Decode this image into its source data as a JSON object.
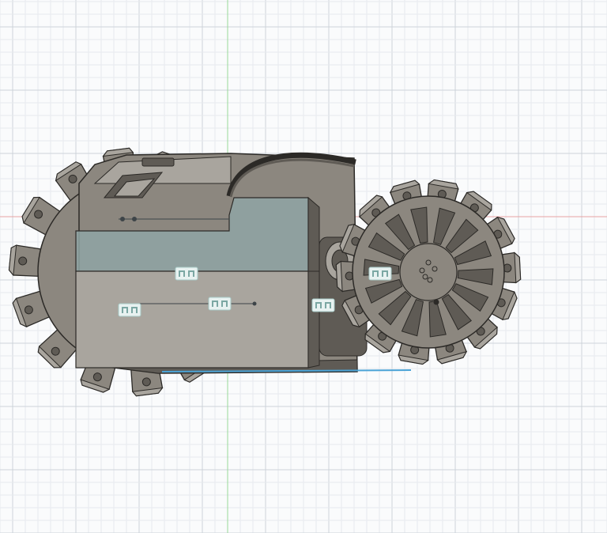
{
  "viewport": {
    "background": "#fafbfc",
    "grid_minor_color": "#e7eaee",
    "grid_major_color": "#cdd3da",
    "x_axis_color": "#e8a3a3",
    "y_axis_color": "#98d898"
  },
  "model": {
    "body_color": "#8c877f",
    "body_light": "#a9a59e",
    "body_dark": "#5f5b55",
    "outline": "#2c2a27",
    "sketch_plane_color": "#8fa4a4",
    "selection_edge_color": "#4aa3d6"
  },
  "markers": [
    {
      "name": "constraint-marker-1",
      "icon": "coincident-constraint-icon"
    },
    {
      "name": "constraint-marker-2",
      "icon": "coincident-constraint-icon"
    },
    {
      "name": "constraint-marker-3",
      "icon": "coincident-constraint-icon"
    },
    {
      "name": "constraint-marker-4",
      "icon": "coincident-constraint-icon"
    },
    {
      "name": "constraint-marker-5",
      "icon": "coincident-constraint-icon"
    }
  ]
}
